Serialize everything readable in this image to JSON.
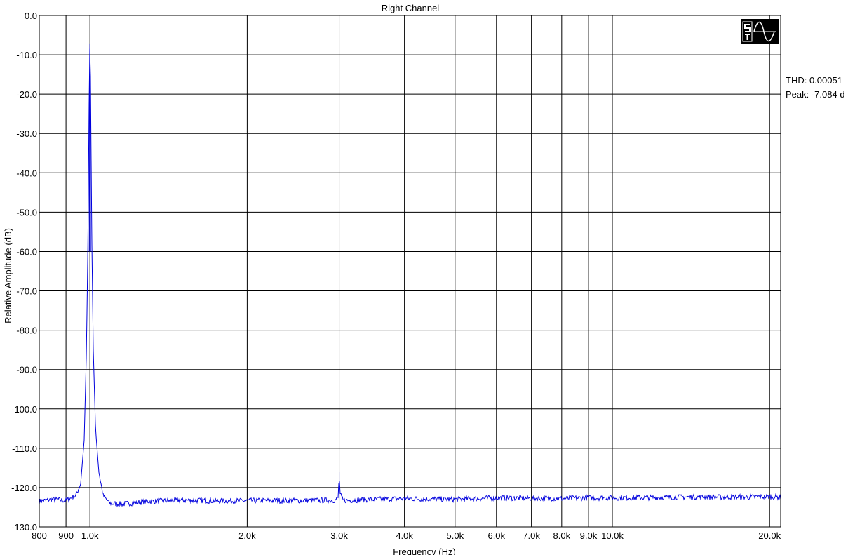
{
  "chart_data": {
    "type": "line",
    "title": "Right Channel",
    "xlabel": "Frequency (Hz)",
    "ylabel": "Relative Amplitude (dB)",
    "x_scale": "log",
    "xlim": [
      800,
      21000
    ],
    "ylim": [
      -130,
      0
    ],
    "grid": true,
    "x_ticks": [
      {
        "value": 800,
        "label": "800"
      },
      {
        "value": 900,
        "label": "900"
      },
      {
        "value": 1000,
        "label": "1.0k"
      },
      {
        "value": 2000,
        "label": "2.0k"
      },
      {
        "value": 3000,
        "label": "3.0k"
      },
      {
        "value": 4000,
        "label": "4.0k"
      },
      {
        "value": 5000,
        "label": "5.0k"
      },
      {
        "value": 6000,
        "label": "6.0k"
      },
      {
        "value": 7000,
        "label": "7.0k"
      },
      {
        "value": 8000,
        "label": "8.0k"
      },
      {
        "value": 9000,
        "label": "9.0k"
      },
      {
        "value": 10000,
        "label": "10.0k"
      },
      {
        "value": 20000,
        "label": "20.0k"
      }
    ],
    "y_ticks": [
      {
        "value": 0,
        "label": "0.0"
      },
      {
        "value": -10,
        "label": "-10.0"
      },
      {
        "value": -20,
        "label": "-20.0"
      },
      {
        "value": -30,
        "label": "-30.0"
      },
      {
        "value": -40,
        "label": "-40.0"
      },
      {
        "value": -50,
        "label": "-50.0"
      },
      {
        "value": -60,
        "label": "-60.0"
      },
      {
        "value": -70,
        "label": "-70.0"
      },
      {
        "value": -80,
        "label": "-80.0"
      },
      {
        "value": -90,
        "label": "-90.0"
      },
      {
        "value": -100,
        "label": "-100.0"
      },
      {
        "value": -110,
        "label": "-110.0"
      },
      {
        "value": -120,
        "label": "-120.0"
      },
      {
        "value": -130,
        "label": "-130.0"
      }
    ],
    "series": [
      {
        "color": "#0000dd",
        "x": [
          800,
          850,
          900,
          940,
          960,
          975,
          985,
          992,
          996,
          998,
          1000,
          1002,
          1004,
          1008,
          1015,
          1025,
          1040,
          1060,
          1090,
          1150,
          1300,
          1500,
          1800,
          2200,
          2600,
          2950,
          2990,
          3000,
          3010,
          3050,
          3500,
          4000,
          5000,
          6000,
          7000,
          8000,
          9000,
          10000,
          12000,
          14000,
          16000,
          18000,
          20000,
          21000
        ],
        "y": [
          -123.5,
          -123.0,
          -123.3,
          -122.0,
          -119.0,
          -108.0,
          -85.0,
          -55.0,
          -25.0,
          -12.0,
          -7.1,
          -12.0,
          -25.0,
          -55.0,
          -85.0,
          -105.0,
          -116.0,
          -122.0,
          -124.0,
          -124.2,
          -123.5,
          -123.2,
          -123.4,
          -123.3,
          -123.3,
          -123.2,
          -122.5,
          -116.0,
          -121.5,
          -123.3,
          -123.0,
          -122.8,
          -123.0,
          -122.6,
          -122.7,
          -122.8,
          -122.6,
          -122.6,
          -122.5,
          -122.4,
          -122.4,
          -122.4,
          -122.3,
          -122.4
        ]
      }
    ],
    "annotations": {
      "thd": "THD: 0.00051",
      "peak": "Peak: -7.084 d"
    }
  }
}
